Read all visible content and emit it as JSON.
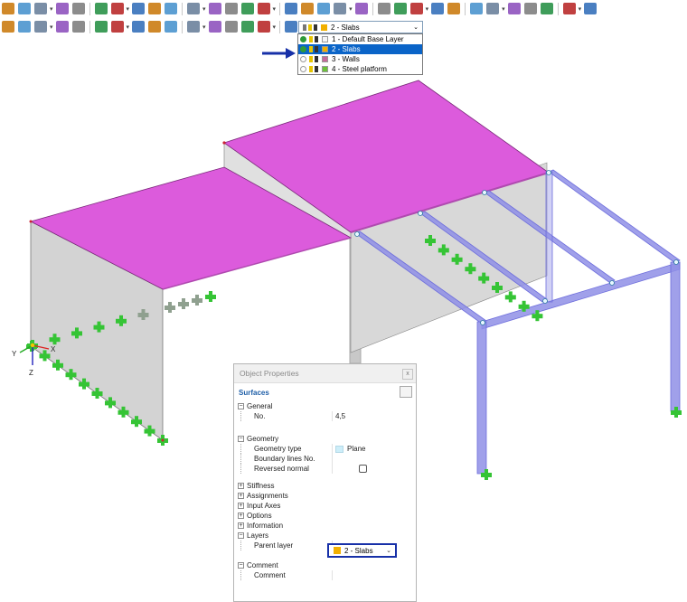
{
  "colors": {
    "slab": "#dc5bdc",
    "wall": "#c9c9c9",
    "beam": "#8f8fe6",
    "support": "#35c435",
    "selection": "#0a64c8",
    "annotation_blue": "#1730a8"
  },
  "toolbar": {
    "row1_icons": [
      "view-icon",
      "axis-xyz-icon",
      "axis-xyz-icon",
      "grid-icon",
      "render-icon",
      "eye-icon",
      "cross-icon",
      "colorscale-icon",
      "load-icon",
      "delete-icon",
      "cube-icon",
      "cube-icon",
      "cube-icon",
      "cube-icon",
      "measure-icon",
      "xyz-icon",
      "xyz-icon",
      "xyz-icon",
      "xyz-icon",
      "section-icon",
      "number-icon",
      "table-icon",
      "table-icon",
      "table-icon",
      "layers-icon",
      "clipping-icon",
      "dimension-icon",
      "ten-icon",
      "zoom-icon",
      "ruler-icon",
      "star-icon",
      "cube-icon"
    ],
    "row2_icons": [
      "pin-icon",
      "line-icon",
      "snap-icon",
      "grid-icon",
      "snap-icon",
      "snap-icon",
      "snap-icon",
      "snap-icon",
      "guide-icon",
      "guide-icon",
      "intersect-icon",
      "cross-icon",
      "camera-icon",
      "layer-icon",
      "layer-icon",
      "layer-icon",
      "layer-icon"
    ]
  },
  "layer_dropdown": {
    "selected": "2 - Slabs",
    "items": [
      {
        "label": "1 - Default Base Layer",
        "color": "#f5f5f5",
        "checked": true
      },
      {
        "label": "2 - Slabs",
        "color": "#f2b000",
        "checked": true
      },
      {
        "label": "3 - Walls",
        "color": "#c86a9a",
        "checked": false
      },
      {
        "label": "4 - Steel platform",
        "color": "#6cc23a",
        "checked": false
      }
    ]
  },
  "scene": {
    "axis_labels": {
      "x": "X",
      "y": "Y",
      "z": "Z"
    }
  },
  "object_properties": {
    "title": "Object Properties",
    "close": "x",
    "section": "Surfaces",
    "general": {
      "label": "General",
      "fields": [
        {
          "name": "No.",
          "value": "4,5"
        }
      ]
    },
    "geometry": {
      "label": "Geometry",
      "type_label": "Geometry type",
      "type_value": "Plane",
      "boundary_label": "Boundary lines No.",
      "boundary_value": "",
      "reversed_label": "Reversed normal"
    },
    "collapsed": [
      "Stiffness",
      "Assignments",
      "Input Axes",
      "Options",
      "Information"
    ],
    "layers": {
      "label": "Layers",
      "parent_label": "Parent layer",
      "parent_value": "2 - Slabs"
    },
    "comment": {
      "label": "Comment",
      "field_label": "Comment",
      "field_value": ""
    },
    "toggle_open": "−",
    "toggle_closed": "+"
  }
}
